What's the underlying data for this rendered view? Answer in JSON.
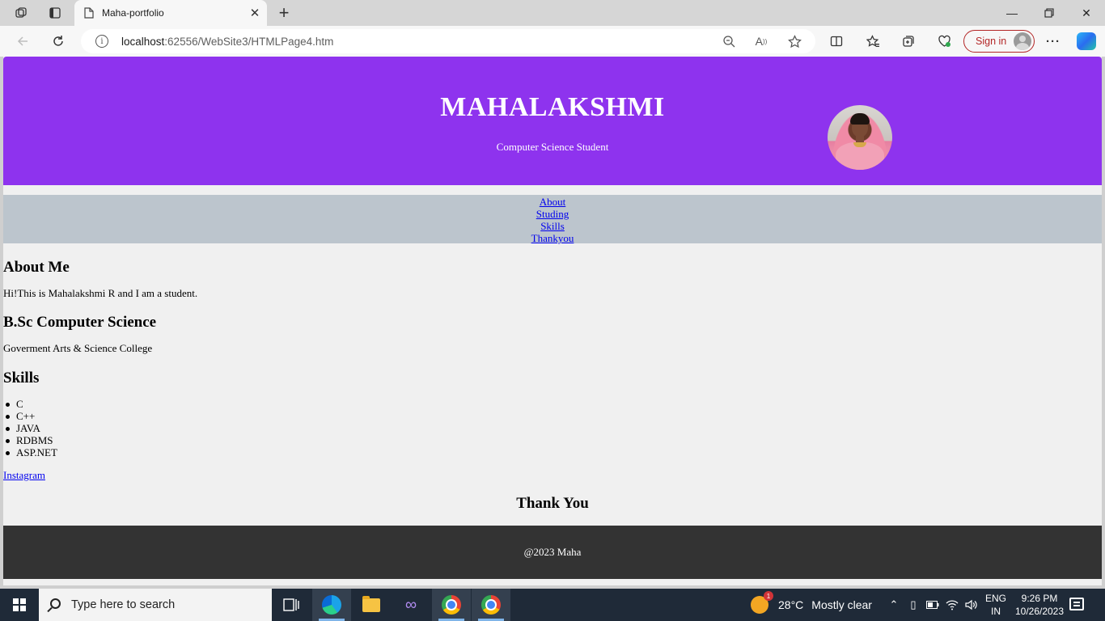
{
  "browser": {
    "tab_title": "Maha-portfolio",
    "url_host": "localhost",
    "url_rest": ":62556/WebSite3/HTMLPage4.htm",
    "signin_label": "Sign in",
    "accent": "#b32626"
  },
  "page": {
    "hero": {
      "title": "MAHALAKSHMI",
      "subtitle": "Computer Science Student",
      "background": "#8e33ee"
    },
    "nav": [
      {
        "label": "About"
      },
      {
        "label": "Studing"
      },
      {
        "label": "Skills"
      },
      {
        "label": "Thankyou"
      }
    ],
    "about": {
      "heading": "About Me",
      "text": "Hi!This is Mahalakshmi R and I am a student."
    },
    "study": {
      "heading": "B.Sc Computer Science",
      "text": "Goverment Arts & Science College"
    },
    "skills": {
      "heading": "Skills",
      "items": [
        "C",
        "C++",
        "JAVA",
        "RDBMS",
        "ASP.NET"
      ]
    },
    "instagram_link": "Instagram",
    "thanks": "Thank You",
    "footer": "@2023 Maha"
  },
  "taskbar": {
    "search_placeholder": "Type here to search",
    "weather_temp": "28°C",
    "weather_cond": "Mostly clear",
    "weather_badge": "1",
    "lang_line1": "ENG",
    "lang_line2": "IN",
    "time": "9:26 PM",
    "date": "10/26/2023"
  }
}
